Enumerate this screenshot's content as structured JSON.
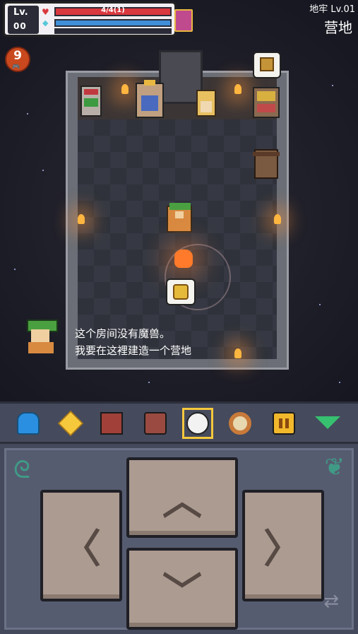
{
  "hud": {
    "level_label": "Lv.",
    "level_value": "00",
    "hp_text": "4/4(1)",
    "hp_color": "#d9383f",
    "mp_color": "#3f8fd9"
  },
  "location": {
    "dungeon": "地牢 Lv.01",
    "area": "营地"
  },
  "game_center_badge": {
    "count": "9"
  },
  "dialog": {
    "line1": "这个房间没有魔兽。",
    "line2": "我要在这裡建造一个营地"
  },
  "toolbar": {
    "items": [
      {
        "icon": "character-icon"
      },
      {
        "icon": "skill-star-icon"
      },
      {
        "icon": "spellbook-icon"
      },
      {
        "icon": "backpack-icon"
      },
      {
        "icon": "explore-icon",
        "selected": true
      },
      {
        "icon": "search-icon"
      },
      {
        "icon": "pause-icon"
      },
      {
        "icon": "collapse-arrow-icon"
      }
    ]
  },
  "dpad": {
    "up": "︿",
    "down": "﹀",
    "left": "〈",
    "right": "〉"
  }
}
